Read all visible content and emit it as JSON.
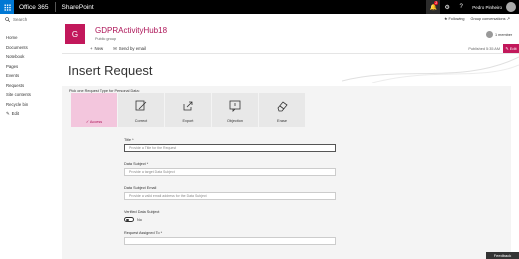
{
  "suitebar": {
    "brand": "Office 365",
    "app": "SharePoint",
    "notification_count": "2",
    "user_name": "Pedro Pinheiro",
    "help_glyph": "?"
  },
  "nav": {
    "search_placeholder": "Search",
    "items": [
      "Home",
      "Documents",
      "Notebook",
      "Pages",
      "Events",
      "Requests",
      "Site contents",
      "Recycle bin"
    ],
    "edit_label": "Edit"
  },
  "site": {
    "logo_letter": "G",
    "title": "GDPRActivityHub18",
    "subtitle": "Public group",
    "following": "Following",
    "group_conversations": "Group conversations",
    "members": "1 member"
  },
  "commandbar": {
    "new_label": "New",
    "send_label": "Send by email",
    "published": "Published 5:35 AM",
    "edit_label": "Edit"
  },
  "page": {
    "title": "Insert Request"
  },
  "request_picker": {
    "label": "Pick one Request Type for Personal Data:",
    "tiles": [
      {
        "label": "Access",
        "icon": "check-icon",
        "selected": true
      },
      {
        "label": "Correct",
        "icon": "edit-icon",
        "selected": false
      },
      {
        "label": "Export",
        "icon": "export-icon",
        "selected": false
      },
      {
        "label": "Objection",
        "icon": "objection-icon",
        "selected": false
      },
      {
        "label": "Erase",
        "icon": "eraser-icon",
        "selected": false
      }
    ]
  },
  "form": {
    "title_label": "Title *",
    "title_placeholder": "Provide a Title for the Request",
    "subject_label": "Data Subject *",
    "subject_placeholder": "Provide a target Data Subject",
    "email_label": "Data Subject Email",
    "email_placeholder": "Provide a valid email address for the Data Subject",
    "verified_label": "Verified Data Subject",
    "verified_value": "No",
    "assigned_label": "Request Assigned To *"
  },
  "feedback_label": "Feedback",
  "colors": {
    "accent": "#c2185b",
    "suitebar": "#000000",
    "waffle": "#0078d4",
    "selected_tile": "#f3c6dd"
  }
}
